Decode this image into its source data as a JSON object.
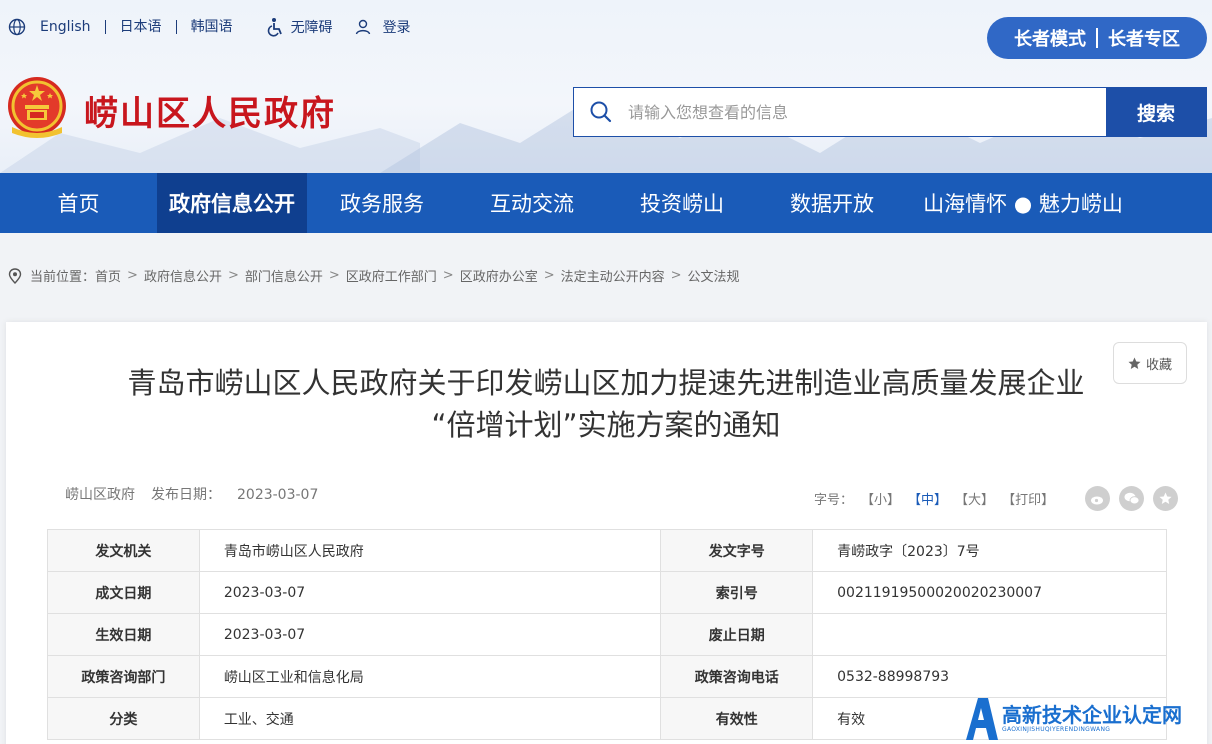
{
  "topbar": {
    "languages": [
      "English",
      "日本语",
      "韩国语"
    ],
    "accessibility": "无障碍",
    "login": "登录"
  },
  "elder": {
    "mode": "长者模式",
    "zone": "长者专区"
  },
  "site": {
    "title": "崂山区人民政府"
  },
  "search": {
    "placeholder": "请输入您想查看的信息",
    "button": "搜索"
  },
  "nav": {
    "items": [
      "首页",
      "政府信息公开",
      "政务服务",
      "互动交流",
      "投资崂山",
      "数据开放",
      "山海情怀 ● 魅力崂山"
    ],
    "active_index": 1
  },
  "breadcrumb": {
    "label": "当前位置：",
    "items": [
      "首页",
      "政府信息公开",
      "部门信息公开",
      "区政府工作部门",
      "区政府办公室",
      "法定主动公开内容",
      "公文法规"
    ]
  },
  "document": {
    "favorite": "收藏",
    "title_line1": "青岛市崂山区人民政府关于印发崂山区加力提速先进制造业高质量发展企业",
    "title_line2": "“倍增计划”实施方案的通知",
    "source": "崂山区政府",
    "publish_label": "发布日期：",
    "publish_date": "2023-03-07",
    "font_label": "字号：",
    "font_sizes": [
      "【小】",
      "【中】",
      "【大】",
      "【打印】"
    ],
    "font_active_index": 1
  },
  "info_table": [
    {
      "k1": "发文机关",
      "v1": "青岛市崂山区人民政府",
      "k2": "发文字号",
      "v2": "青崂政字〔2023〕7号"
    },
    {
      "k1": "成文日期",
      "v1": "2023-03-07",
      "k2": "索引号",
      "v2": "00211919500020020230007"
    },
    {
      "k1": "生效日期",
      "v1": "2023-03-07",
      "k2": "废止日期",
      "v2": ""
    },
    {
      "k1": "政策咨询部门",
      "v1": "崂山区工业和信息化局",
      "k2": "政策咨询电话",
      "v2": "0532-88998793"
    },
    {
      "k1": "分类",
      "v1": "工业、交通",
      "k2": "有效性",
      "v2": "有效"
    }
  ],
  "watermark": {
    "text": "高新技术企业认定网",
    "sub": "GAOXINJISHUQIYERENDINGWANG"
  },
  "colors": {
    "primary": "#1a5bb8",
    "nav_active": "#0f3f8f",
    "title_red": "#c8161d"
  }
}
